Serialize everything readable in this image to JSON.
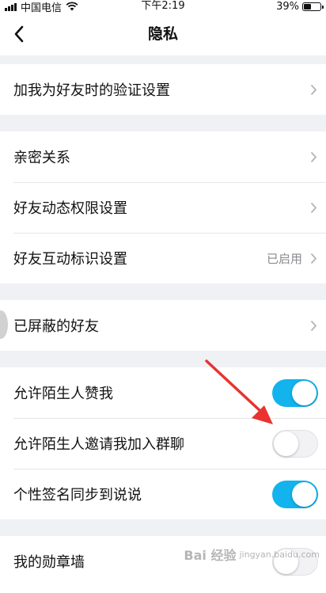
{
  "status_bar": {
    "carrier": "中国电信",
    "time": "下午2:19",
    "battery_percent": "39%",
    "battery_level": 0.39,
    "icons": [
      "signal-icon",
      "wifi-icon",
      "battery-icon"
    ]
  },
  "header": {
    "title": "隐私",
    "back_icon": "chevron-left-icon"
  },
  "groups": {
    "verification": {
      "items": [
        {
          "label": "加我为好友时的验证设置",
          "type": "link"
        }
      ]
    },
    "relations": {
      "items": [
        {
          "label": "亲密关系",
          "type": "link"
        },
        {
          "label": "好友动态权限设置",
          "type": "link"
        },
        {
          "label": "好友互动标识设置",
          "type": "link",
          "value": "已启用"
        }
      ]
    },
    "blocked": {
      "items": [
        {
          "label": "已屏蔽的好友",
          "type": "link"
        }
      ]
    },
    "permissions": {
      "items": [
        {
          "label": "允许陌生人赞我",
          "type": "toggle",
          "on": true
        },
        {
          "label": "允许陌生人邀请我加入群聊",
          "type": "toggle",
          "on": false
        },
        {
          "label": "个性签名同步到说说",
          "type": "toggle",
          "on": true
        }
      ]
    },
    "medals": {
      "items": [
        {
          "label": "我的勋章墙",
          "type": "toggle",
          "on": false
        }
      ]
    }
  },
  "colors": {
    "toggle_on": "#13b3ed",
    "annotation_arrow": "#e8332f",
    "background": "#f0f1f5"
  },
  "watermark": {
    "text": "Bai 经验",
    "sub": "jingyan.baidu.com"
  }
}
